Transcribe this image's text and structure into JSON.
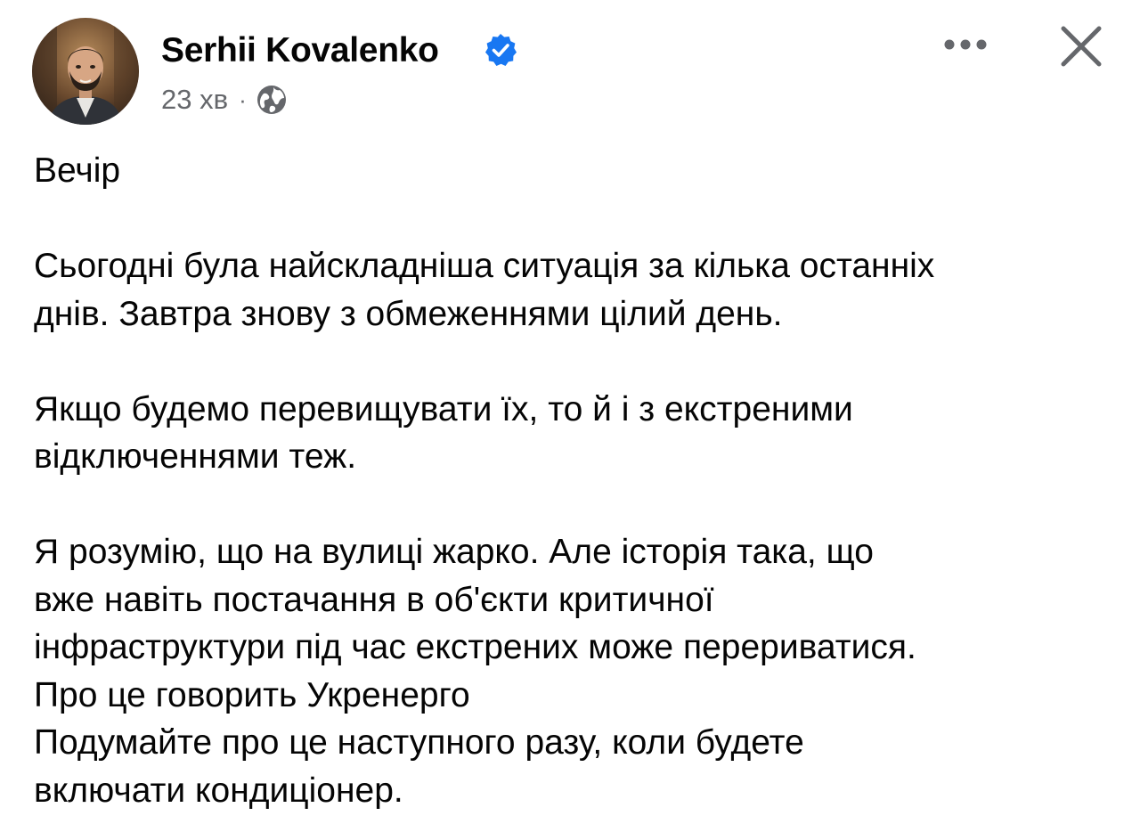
{
  "post": {
    "author": {
      "name": "Serhii Kovalenko",
      "verified": true,
      "avatar_icon": "profile-photo"
    },
    "timestamp": "23 хв",
    "separator": "·",
    "privacy_icon": "globe-icon",
    "actions": {
      "more_icon": "ellipsis-icon",
      "close_icon": "close-icon"
    },
    "body": {
      "line_1": "Вечір",
      "line_2": "Сьогодні була найскладніша ситуація за кілька останніх",
      "line_3": "днів. Завтра знову з обмеженнями цілий день.",
      "line_4": "Якщо будемо перевищувати їх, то й і з екстреними",
      "line_5": "відключеннями теж.",
      "line_6": "Я розумію, що на вулиці жарко. Але історія така, що",
      "line_7": "вже навіть постачання в об'єкти критичної",
      "line_8": "інфраструктури під час екстрених може перериватися.",
      "line_9": "Про це говорить Укренерго",
      "line_10": "Подумайте про це наступного разу, коли будете",
      "line_11": "включати кондиціонер."
    }
  },
  "colors": {
    "text": "#050505",
    "secondary_text": "#65676b",
    "verified_badge": "#1877f2",
    "icon_gray": "#65676b",
    "background": "#ffffff"
  }
}
